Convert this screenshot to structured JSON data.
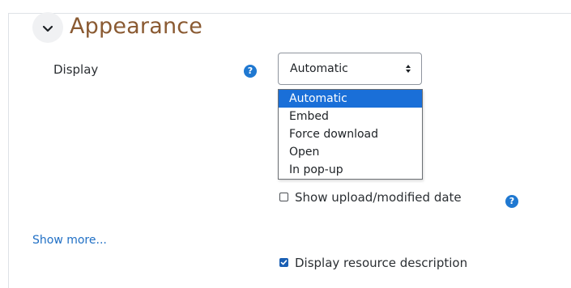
{
  "section": {
    "title": "Appearance",
    "toggle_icon": "chevron-down-icon"
  },
  "display_field": {
    "label": "Display",
    "help_icon": "question-circle-icon",
    "help_glyph": "?",
    "selected": "Automatic",
    "options": [
      "Automatic",
      "Embed",
      "Force download",
      "Open",
      "In pop-up"
    ]
  },
  "show_date": {
    "label": "Show upload/modified date",
    "checked": false,
    "help_glyph": "?"
  },
  "show_more": {
    "label": "Show more..."
  },
  "display_description": {
    "label": "Display resource description",
    "checked": true
  },
  "colors": {
    "section_title": "#8a5a32",
    "link": "#1f6fc5",
    "selected_option": "#1a6fd8",
    "help_icon": "#1f78d1"
  }
}
